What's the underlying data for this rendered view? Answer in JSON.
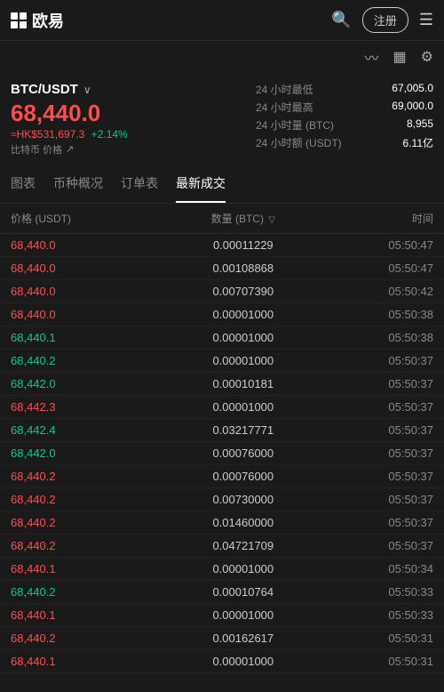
{
  "header": {
    "logo_text": "欧易",
    "register_label": "注册",
    "menu_icon": "☰",
    "search_icon": "🔍"
  },
  "sub_header": {
    "chart_icon": "📈",
    "grid_icon": "▦",
    "settings_icon": "⚙"
  },
  "market": {
    "pair": "BTC/USDT",
    "price": "68,440.0",
    "price_hk": "≈HK$531,697.3",
    "change": "+2.14%",
    "label": "比特币 价格",
    "external_link": "↗",
    "stats": [
      {
        "label": "24 小时最低",
        "value": "67,005.0"
      },
      {
        "label": "24 小时最高",
        "value": "69,000.0"
      },
      {
        "label": "24 小时量 (BTC)",
        "value": "8,955"
      },
      {
        "label": "24 小时额 (USDT)",
        "value": "6.11亿"
      }
    ]
  },
  "tabs": [
    {
      "id": "chart",
      "label": "图表"
    },
    {
      "id": "overview",
      "label": "币种概况"
    },
    {
      "id": "orders",
      "label": "订单表"
    },
    {
      "id": "trades",
      "label": "最新成交",
      "active": true
    }
  ],
  "table": {
    "headers": [
      {
        "id": "price",
        "label": "价格 (USDT)"
      },
      {
        "id": "qty",
        "label": "数量 (BTC)"
      },
      {
        "id": "time",
        "label": "时间"
      }
    ],
    "rows": [
      {
        "price": "68,440.0",
        "color": "red",
        "qty": "0.00011229",
        "time": "05:50:47"
      },
      {
        "price": "68,440.0",
        "color": "red",
        "qty": "0.00108868",
        "time": "05:50:47"
      },
      {
        "price": "68,440.0",
        "color": "red",
        "qty": "0.00707390",
        "time": "05:50:42"
      },
      {
        "price": "68,440.0",
        "color": "red",
        "qty": "0.00001000",
        "time": "05:50:38"
      },
      {
        "price": "68,440.1",
        "color": "green",
        "qty": "0.00001000",
        "time": "05:50:38"
      },
      {
        "price": "68,440.2",
        "color": "green",
        "qty": "0.00001000",
        "time": "05:50:37"
      },
      {
        "price": "68,442.0",
        "color": "green",
        "qty": "0.00010181",
        "time": "05:50:37"
      },
      {
        "price": "68,442.3",
        "color": "red",
        "qty": "0.00001000",
        "time": "05:50:37"
      },
      {
        "price": "68,442.4",
        "color": "green",
        "qty": "0.03217771",
        "time": "05:50:37"
      },
      {
        "price": "68,442.0",
        "color": "green",
        "qty": "0.00076000",
        "time": "05:50:37"
      },
      {
        "price": "68,440.2",
        "color": "red",
        "qty": "0.00076000",
        "time": "05:50:37"
      },
      {
        "price": "68,440.2",
        "color": "red",
        "qty": "0.00730000",
        "time": "05:50:37"
      },
      {
        "price": "68,440.2",
        "color": "red",
        "qty": "0.01460000",
        "time": "05:50:37"
      },
      {
        "price": "68,440.2",
        "color": "red",
        "qty": "0.04721709",
        "time": "05:50:37"
      },
      {
        "price": "68,440.1",
        "color": "red",
        "qty": "0.00001000",
        "time": "05:50:34"
      },
      {
        "price": "68,440.2",
        "color": "green",
        "qty": "0.00010764",
        "time": "05:50:33"
      },
      {
        "price": "68,440.1",
        "color": "red",
        "qty": "0.00001000",
        "time": "05:50:33"
      },
      {
        "price": "68,440.2",
        "color": "red",
        "qty": "0.00162617",
        "time": "05:50:31"
      },
      {
        "price": "68,440.1",
        "color": "red",
        "qty": "0.00001000",
        "time": "05:50:31"
      }
    ]
  }
}
